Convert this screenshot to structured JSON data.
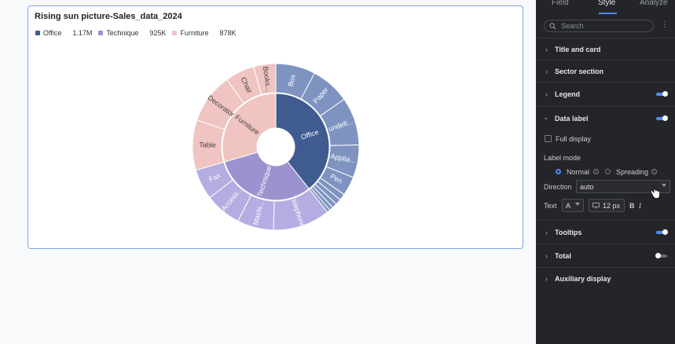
{
  "card": {
    "title": "Rising sun picture-Sales_data_2024"
  },
  "legend": [
    {
      "name": "Office",
      "value": "1.17M",
      "color": "#3f5b8f"
    },
    {
      "name": "Technique",
      "value": "925K",
      "color": "#9c92cf"
    },
    {
      "name": "Furniture",
      "value": "878K",
      "color": "#efc4c1"
    }
  ],
  "chart_data": {
    "type": "sunburst",
    "inner": [
      {
        "name": "Office",
        "value": 1170,
        "color": "#3f5b8f"
      },
      {
        "name": "Technique",
        "value": 925,
        "color": "#9c92cf"
      },
      {
        "name": "Furniture",
        "value": 878,
        "color": "#efc4c1"
      }
    ],
    "outer": [
      {
        "name": "Box",
        "parent": "Office",
        "value": 182
      },
      {
        "name": "Paper",
        "parent": "Office",
        "value": 180
      },
      {
        "name": "undefi...",
        "parent": "Office",
        "value": 220
      },
      {
        "name": "Applia...",
        "parent": "Office",
        "value": 150
      },
      {
        "name": "Pen",
        "parent": "Office",
        "value": 88
      },
      {
        "name": "",
        "parent": "Office",
        "value": 30
      },
      {
        "name": "",
        "parent": "Office",
        "value": 26
      },
      {
        "name": "",
        "parent": "Office",
        "value": 22
      },
      {
        "name": "",
        "parent": "Office",
        "value": 18
      },
      {
        "name": "",
        "parent": "Office",
        "value": 14
      },
      {
        "name": "Telephone",
        "parent": "Technique",
        "value": 330
      },
      {
        "name": "Machi...",
        "parent": "Technique",
        "value": 210
      },
      {
        "name": "Access...",
        "parent": "Technique",
        "value": 210
      },
      {
        "name": "Fax",
        "parent": "Technique",
        "value": 175
      },
      {
        "name": "Table",
        "parent": "Furniture",
        "value": 290
      },
      {
        "name": "Decorator",
        "parent": "Furniture",
        "value": 290
      },
      {
        "name": "Chair",
        "parent": "Furniture",
        "value": 170
      },
      {
        "name": "Books...",
        "parent": "Furniture",
        "value": 128
      }
    ]
  },
  "panel": {
    "tabs": [
      "Field",
      "Style",
      "Analyze"
    ],
    "active_tab": "Style",
    "search_placeholder": "Search",
    "sections": {
      "title_card": "Title and card",
      "sector": "Sector section",
      "legend": "Legend",
      "data_label": "Data label",
      "tooltips": "Tooltips",
      "total": "Total",
      "auxiliary": "Auxiliary display"
    },
    "full_display": "Full display",
    "label_mode": "Label mode",
    "mode_normal": "Normal",
    "mode_spreading": "Spreading",
    "direction_label": "Direction",
    "direction_value": "auto",
    "text_label": "Text",
    "text_font_icon": "A",
    "text_size": "12 px",
    "bold": "B",
    "italic": "I",
    "accent": "#4a8cf7"
  }
}
